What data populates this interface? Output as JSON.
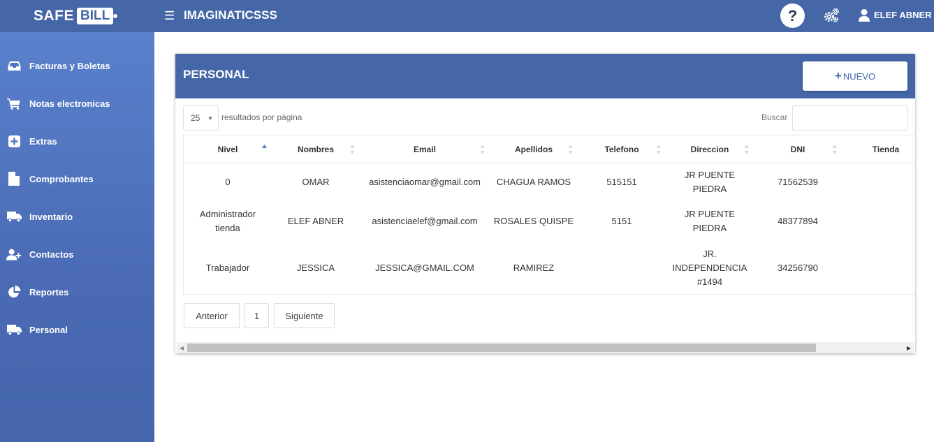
{
  "header": {
    "logo_safe": "SAFE",
    "logo_bill": "BILL",
    "menu_icon": "hamburger-icon",
    "company": "IMAGINATICSSS",
    "help_label": "?",
    "settings_icon": "gears-icon",
    "user_name": "ELEF ABNER",
    "brand_color": "#4567a8"
  },
  "sidebar": {
    "items": [
      {
        "label": "Facturas y Boletas",
        "icon": "inbox-icon"
      },
      {
        "label": "Notas electronicas",
        "icon": "cart-icon"
      },
      {
        "label": "Extras",
        "icon": "plus-square-icon"
      },
      {
        "label": "Comprobantes",
        "icon": "file-icon"
      },
      {
        "label": "Inventario",
        "icon": "truck-icon"
      },
      {
        "label": "Contactos",
        "icon": "add-user-icon"
      },
      {
        "label": "Reportes",
        "icon": "pie-chart-icon"
      },
      {
        "label": "Personal",
        "icon": "truck-icon"
      }
    ]
  },
  "panel": {
    "title": "PERSONAL",
    "new_button": "NUEVO",
    "page_length": "25",
    "page_length_label": "resultados por página",
    "search_label": "Buscar",
    "search_value": ""
  },
  "table": {
    "columns": [
      "Nivel",
      "Nombres",
      "Email",
      "Apellidos",
      "Telefono",
      "Direccion",
      "DNI",
      "Tienda"
    ],
    "rows": [
      {
        "nivel": "0",
        "nombres": "OMAR",
        "email": "asistenciaomar@gmail.com",
        "apellidos": "CHAGUA RAMOS",
        "telefono": "515151",
        "direccion": "JR PUENTE PIEDRA",
        "dni": "71562539",
        "tienda": ""
      },
      {
        "nivel": "Administrador tienda",
        "nombres": "ELEF ABNER",
        "email": "asistenciaelef@gmail.com",
        "apellidos": "ROSALES QUISPE",
        "telefono": "5151",
        "direccion": "JR PUENTE PIEDRA",
        "dni": "48377894",
        "tienda": ""
      },
      {
        "nivel": "Trabajador",
        "nombres": "JESSICA",
        "email": "JESSICA@GMAIL.COM",
        "apellidos": "RAMIREZ",
        "telefono": "",
        "direccion": "JR. INDEPENDENCIA #1494",
        "dni": "34256790",
        "tienda": ""
      }
    ]
  },
  "pagination": {
    "prev": "Anterior",
    "current": "1",
    "next": "Siguiente"
  }
}
